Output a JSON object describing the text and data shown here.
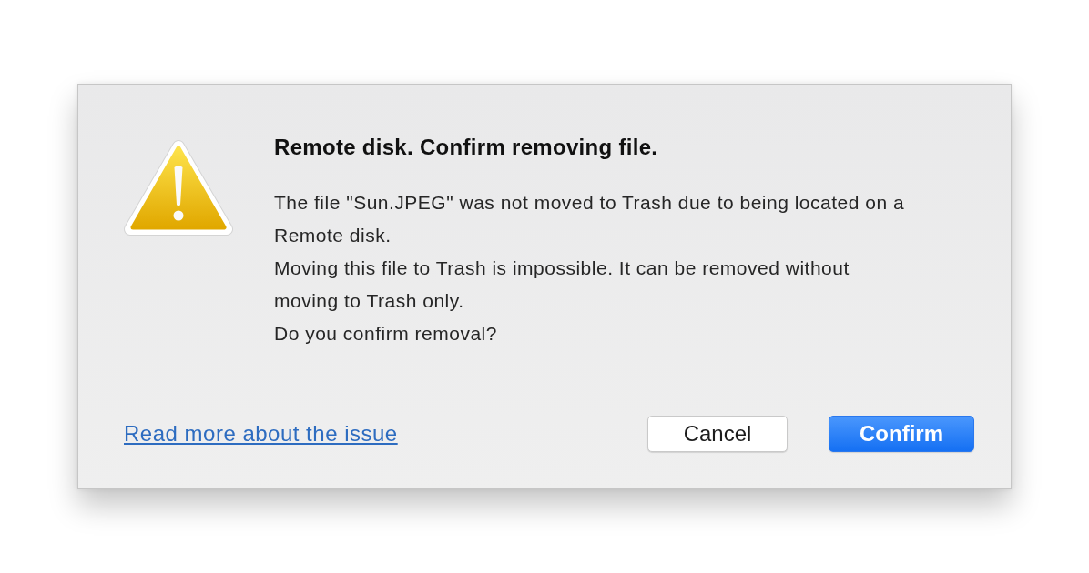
{
  "dialog": {
    "title": "Remote disk. Confirm removing file.",
    "message": [
      "The file \"Sun.JPEG\" was not moved to Trash due to being located on a Remote disk.",
      "Moving this file to Trash is impossible. It can be removed without moving to Trash only.",
      "Do you confirm removal?"
    ],
    "link": "Read more about the issue",
    "buttons": [
      {
        "label": "Cancel",
        "default": false
      },
      {
        "label": "Confirm",
        "default": true
      }
    ]
  }
}
